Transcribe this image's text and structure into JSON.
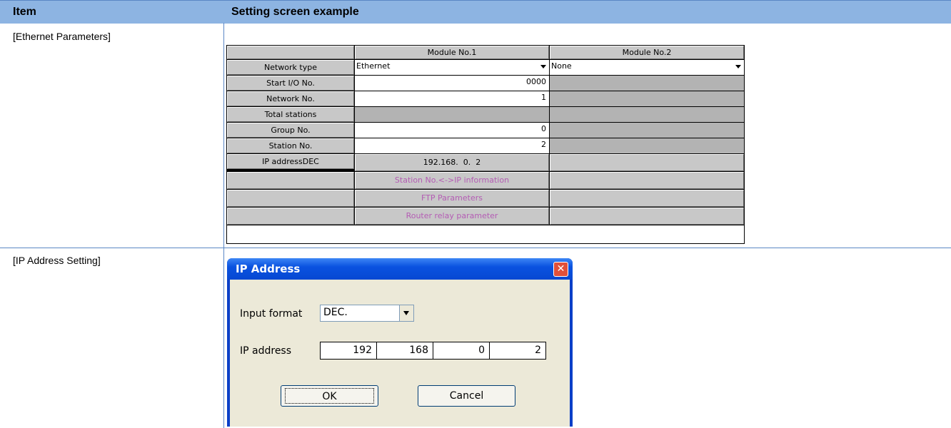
{
  "table": {
    "header_item": "Item",
    "header_example": "Setting screen example",
    "row1_label": "[Ethernet Parameters]",
    "row2_label": "[IP Address Setting]"
  },
  "ethernet": {
    "col1": "Module No.1",
    "col2": "Module No.2",
    "rows": [
      {
        "label": "Network type",
        "m1": "Ethernet",
        "m2": "None"
      },
      {
        "label": "Start I/O No.",
        "m1": "0000"
      },
      {
        "label": "Network No.",
        "m1": "1"
      },
      {
        "label": "Total stations"
      },
      {
        "label": "Group No.",
        "m1": "0"
      },
      {
        "label": "Station No.",
        "m1": "2"
      },
      {
        "label": "IP addressDEC",
        "m1": "192.168.  0.  2"
      }
    ],
    "buttons": [
      "Station No.<->IP information",
      "FTP Parameters",
      "Router relay parameter"
    ]
  },
  "dialog": {
    "title": "IP Address",
    "close_glyph": "✕",
    "input_format_label": "Input format",
    "input_format_value": "DEC.",
    "ip_label": "IP address",
    "octets": [
      "192",
      "168",
      "0",
      "2"
    ],
    "ok_label": "OK",
    "cancel_label": "Cancel"
  },
  "colors": {
    "header_bg": "#8db4e2",
    "border_blue": "#5a87c5",
    "pink_text": "#b45cb4",
    "dialog_title": "#0a52e0"
  }
}
